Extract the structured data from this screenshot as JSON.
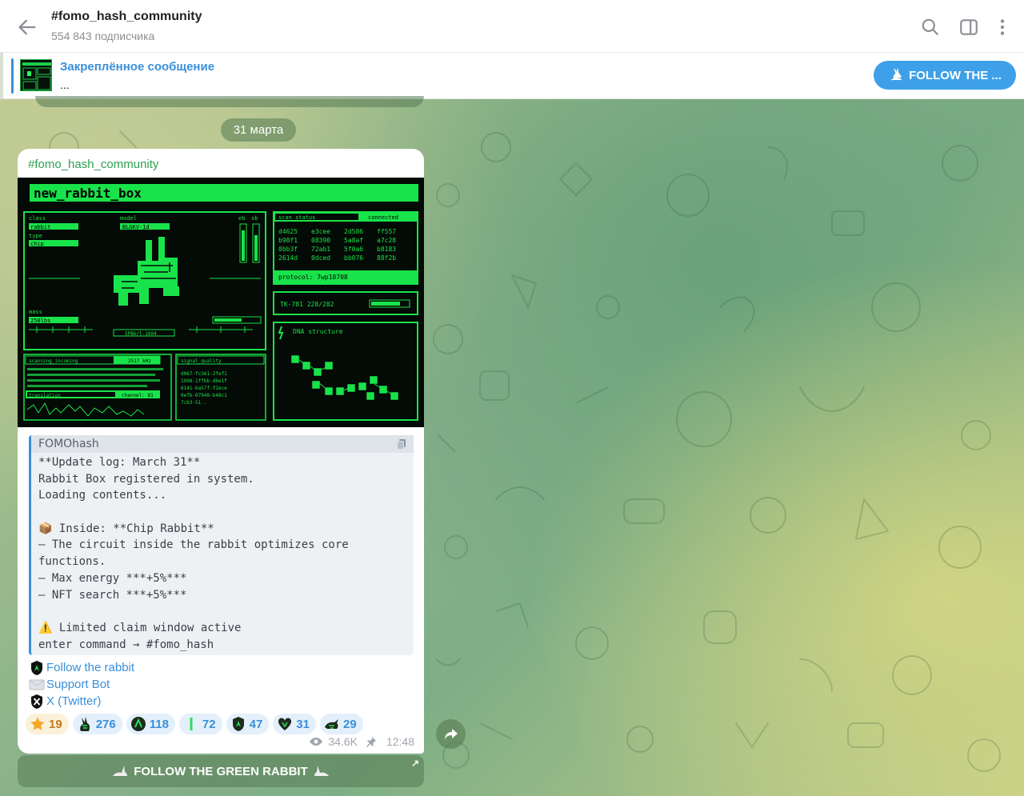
{
  "header": {
    "title": "#fomo_hash_community",
    "subtitle": "554 843 подписчика",
    "icons": [
      "back-arrow-icon",
      "search-icon",
      "sidebar-panel-icon",
      "more-vertical-icon"
    ]
  },
  "pinned": {
    "title": "Закреплённое сообщение",
    "text": "...",
    "button_label": "FOLLOW THE ..."
  },
  "date_pill": "31 марта",
  "message": {
    "author": "#fomo_hash_community",
    "image": {
      "heading": "new_rabbit_box",
      "class_label": "class",
      "class_value": "rabbit",
      "type_label": "type",
      "type_value": "chip",
      "model_label": "model",
      "model_value": "BLGKV-1d",
      "eb_label": "eb",
      "sb_label": "sb",
      "mass_label": "mass",
      "mass_value": "250lbs",
      "serial": "SPBkrl-1004",
      "scan_status": "scan_status",
      "connected": "connected",
      "hex_rows": [
        [
          "d4625",
          "e3cee",
          "2d586",
          "ff557"
        ],
        [
          "b98f1",
          "08390",
          "5a8af",
          "a7c28"
        ],
        [
          "0bb3f",
          "72ab1",
          "5f0a6",
          "b8183"
        ],
        [
          "2614d",
          "0dced",
          "bb076",
          "88f2b"
        ]
      ],
      "protocol": "protocol: 7wp18708",
      "tk": "TK-781 228/282",
      "dna": "DNA structure",
      "scanning": "scanning_incoming",
      "scanning_value": "2517 kHz",
      "translation": "translation",
      "channel": "channel: 81",
      "signal": "signal_quality",
      "signal_lines": [
        "d067-fc361-2fef1",
        "1998-1ffbb-d6e1f",
        "6141-ba57f-f2ece",
        "0efb-07948-b48c1",
        "7cb3-51.."
      ]
    },
    "code": {
      "language": "FOMOhash",
      "lines": [
        "**Update log: March 31**",
        "Rabbit Box registered in system.",
        "Loading contents...",
        "",
        "📦 Inside: **Chip Rabbit**",
        "– The circuit inside the rabbit optimizes core",
        "functions.",
        "– Max energy ***+5%***",
        "– NFT search ***+5%***",
        "",
        "⚠️ Limited claim window active",
        "enter command → #fomo_hash"
      ]
    },
    "links": [
      {
        "label": "Follow the rabbit",
        "icon": "green-shield-icon"
      },
      {
        "label": "Support Bot",
        "icon": "envelope-icon"
      },
      {
        "label": "X (Twitter)",
        "icon": "x-logo-icon"
      }
    ],
    "reactions": [
      {
        "count": "19",
        "icon": "star-icon",
        "style": "gold"
      },
      {
        "count": "276",
        "icon": "green-rabbit-icon",
        "style": "blue"
      },
      {
        "count": "118",
        "icon": "green-circle-icon",
        "style": "blue"
      },
      {
        "count": "72",
        "icon": "green-bar-icon",
        "style": "blue"
      },
      {
        "count": "47",
        "icon": "green-shield-icon",
        "style": "blue"
      },
      {
        "count": "31",
        "icon": "green-heart-icon",
        "style": "blue"
      },
      {
        "count": "29",
        "icon": "green-rabbit-run-icon",
        "style": "blue"
      }
    ],
    "views": "34.6K",
    "time": "12:48"
  },
  "bottom_button": "FOLLOW THE GREEN RABBIT"
}
